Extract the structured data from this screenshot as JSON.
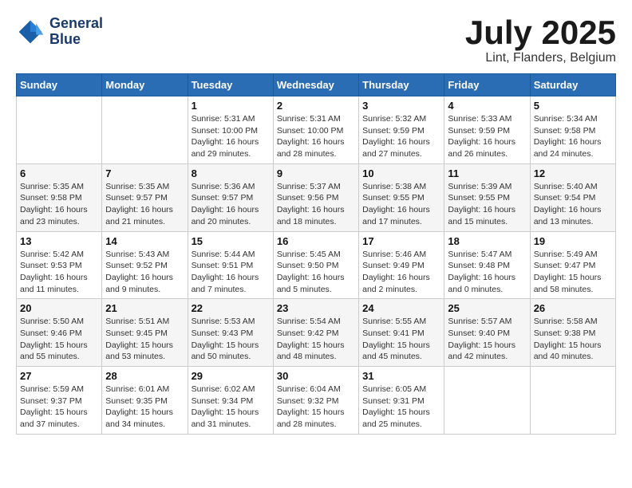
{
  "header": {
    "logo_line1": "General",
    "logo_line2": "Blue",
    "month": "July 2025",
    "location": "Lint, Flanders, Belgium"
  },
  "weekdays": [
    "Sunday",
    "Monday",
    "Tuesday",
    "Wednesday",
    "Thursday",
    "Friday",
    "Saturday"
  ],
  "weeks": [
    [
      {
        "day": "",
        "info": ""
      },
      {
        "day": "",
        "info": ""
      },
      {
        "day": "1",
        "info": "Sunrise: 5:31 AM\nSunset: 10:00 PM\nDaylight: 16 hours\nand 29 minutes."
      },
      {
        "day": "2",
        "info": "Sunrise: 5:31 AM\nSunset: 10:00 PM\nDaylight: 16 hours\nand 28 minutes."
      },
      {
        "day": "3",
        "info": "Sunrise: 5:32 AM\nSunset: 9:59 PM\nDaylight: 16 hours\nand 27 minutes."
      },
      {
        "day": "4",
        "info": "Sunrise: 5:33 AM\nSunset: 9:59 PM\nDaylight: 16 hours\nand 26 minutes."
      },
      {
        "day": "5",
        "info": "Sunrise: 5:34 AM\nSunset: 9:58 PM\nDaylight: 16 hours\nand 24 minutes."
      }
    ],
    [
      {
        "day": "6",
        "info": "Sunrise: 5:35 AM\nSunset: 9:58 PM\nDaylight: 16 hours\nand 23 minutes."
      },
      {
        "day": "7",
        "info": "Sunrise: 5:35 AM\nSunset: 9:57 PM\nDaylight: 16 hours\nand 21 minutes."
      },
      {
        "day": "8",
        "info": "Sunrise: 5:36 AM\nSunset: 9:57 PM\nDaylight: 16 hours\nand 20 minutes."
      },
      {
        "day": "9",
        "info": "Sunrise: 5:37 AM\nSunset: 9:56 PM\nDaylight: 16 hours\nand 18 minutes."
      },
      {
        "day": "10",
        "info": "Sunrise: 5:38 AM\nSunset: 9:55 PM\nDaylight: 16 hours\nand 17 minutes."
      },
      {
        "day": "11",
        "info": "Sunrise: 5:39 AM\nSunset: 9:55 PM\nDaylight: 16 hours\nand 15 minutes."
      },
      {
        "day": "12",
        "info": "Sunrise: 5:40 AM\nSunset: 9:54 PM\nDaylight: 16 hours\nand 13 minutes."
      }
    ],
    [
      {
        "day": "13",
        "info": "Sunrise: 5:42 AM\nSunset: 9:53 PM\nDaylight: 16 hours\nand 11 minutes."
      },
      {
        "day": "14",
        "info": "Sunrise: 5:43 AM\nSunset: 9:52 PM\nDaylight: 16 hours\nand 9 minutes."
      },
      {
        "day": "15",
        "info": "Sunrise: 5:44 AM\nSunset: 9:51 PM\nDaylight: 16 hours\nand 7 minutes."
      },
      {
        "day": "16",
        "info": "Sunrise: 5:45 AM\nSunset: 9:50 PM\nDaylight: 16 hours\nand 5 minutes."
      },
      {
        "day": "17",
        "info": "Sunrise: 5:46 AM\nSunset: 9:49 PM\nDaylight: 16 hours\nand 2 minutes."
      },
      {
        "day": "18",
        "info": "Sunrise: 5:47 AM\nSunset: 9:48 PM\nDaylight: 16 hours\nand 0 minutes."
      },
      {
        "day": "19",
        "info": "Sunrise: 5:49 AM\nSunset: 9:47 PM\nDaylight: 15 hours\nand 58 minutes."
      }
    ],
    [
      {
        "day": "20",
        "info": "Sunrise: 5:50 AM\nSunset: 9:46 PM\nDaylight: 15 hours\nand 55 minutes."
      },
      {
        "day": "21",
        "info": "Sunrise: 5:51 AM\nSunset: 9:45 PM\nDaylight: 15 hours\nand 53 minutes."
      },
      {
        "day": "22",
        "info": "Sunrise: 5:53 AM\nSunset: 9:43 PM\nDaylight: 15 hours\nand 50 minutes."
      },
      {
        "day": "23",
        "info": "Sunrise: 5:54 AM\nSunset: 9:42 PM\nDaylight: 15 hours\nand 48 minutes."
      },
      {
        "day": "24",
        "info": "Sunrise: 5:55 AM\nSunset: 9:41 PM\nDaylight: 15 hours\nand 45 minutes."
      },
      {
        "day": "25",
        "info": "Sunrise: 5:57 AM\nSunset: 9:40 PM\nDaylight: 15 hours\nand 42 minutes."
      },
      {
        "day": "26",
        "info": "Sunrise: 5:58 AM\nSunset: 9:38 PM\nDaylight: 15 hours\nand 40 minutes."
      }
    ],
    [
      {
        "day": "27",
        "info": "Sunrise: 5:59 AM\nSunset: 9:37 PM\nDaylight: 15 hours\nand 37 minutes."
      },
      {
        "day": "28",
        "info": "Sunrise: 6:01 AM\nSunset: 9:35 PM\nDaylight: 15 hours\nand 34 minutes."
      },
      {
        "day": "29",
        "info": "Sunrise: 6:02 AM\nSunset: 9:34 PM\nDaylight: 15 hours\nand 31 minutes."
      },
      {
        "day": "30",
        "info": "Sunrise: 6:04 AM\nSunset: 9:32 PM\nDaylight: 15 hours\nand 28 minutes."
      },
      {
        "day": "31",
        "info": "Sunrise: 6:05 AM\nSunset: 9:31 PM\nDaylight: 15 hours\nand 25 minutes."
      },
      {
        "day": "",
        "info": ""
      },
      {
        "day": "",
        "info": ""
      }
    ]
  ]
}
